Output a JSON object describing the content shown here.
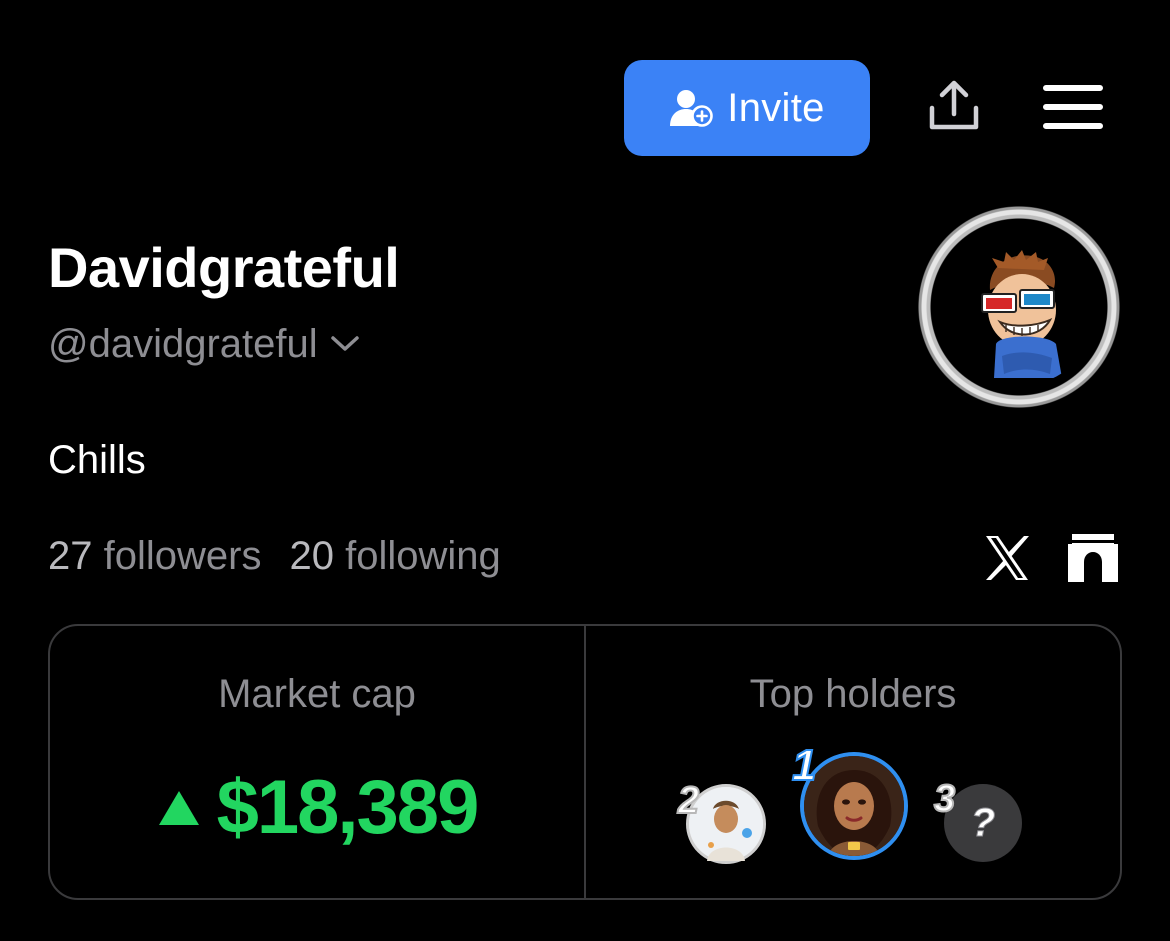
{
  "header": {
    "invite_label": "Invite",
    "icons": {
      "invite": "add-user-icon",
      "share": "share-icon",
      "menu": "hamburger-menu-icon"
    },
    "accent_color": "#3b82f6"
  },
  "profile": {
    "display_name": "Davidgrateful",
    "handle": "@davidgrateful",
    "bio": "Chills",
    "followers_count": "27",
    "followers_label": "followers",
    "following_count": "20",
    "following_label": "following",
    "social_icons": [
      "x-logo-icon",
      "gate-logo-icon"
    ]
  },
  "stats_card": {
    "market_cap": {
      "title": "Market cap",
      "value": "$18,389",
      "trend": "up",
      "color": "#22d660"
    },
    "top_holders": {
      "title": "Top holders",
      "holders": [
        {
          "rank": "2",
          "avatar": "male-avatar"
        },
        {
          "rank": "1",
          "avatar": "female-avatar"
        },
        {
          "rank": "3",
          "avatar": "unknown-avatar",
          "placeholder": "?"
        }
      ]
    }
  }
}
